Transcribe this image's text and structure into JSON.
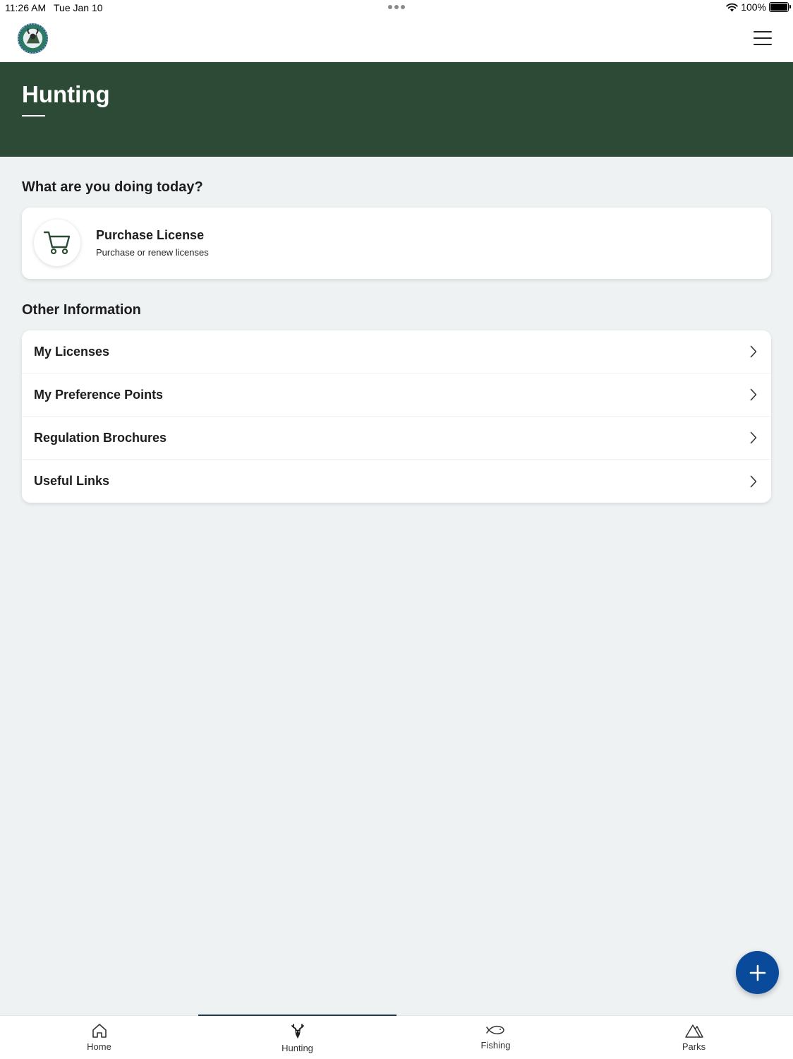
{
  "status_bar": {
    "time": "11:26 AM",
    "date": "Tue Jan 10",
    "battery": "100%"
  },
  "header": {
    "logo_icon": "colorado-parks-wildlife-logo",
    "menu_icon": "hamburger-menu-icon"
  },
  "hero": {
    "title": "Hunting"
  },
  "main": {
    "section1_title": "What are you doing today?",
    "purchase": {
      "title": "Purchase License",
      "subtitle": "Purchase or renew licenses",
      "icon": "shopping-cart-icon"
    },
    "section2_title": "Other Information",
    "info_items": [
      {
        "label": "My Licenses"
      },
      {
        "label": "My Preference Points"
      },
      {
        "label": "Regulation Brochures"
      },
      {
        "label": "Useful Links"
      }
    ]
  },
  "fab": {
    "icon": "plus-icon"
  },
  "bottom_nav": {
    "items": [
      {
        "label": "Home",
        "icon": "home-icon"
      },
      {
        "label": "Hunting",
        "icon": "deer-icon"
      },
      {
        "label": "Fishing",
        "icon": "fish-icon"
      },
      {
        "label": "Parks",
        "icon": "mountain-icon"
      }
    ],
    "active": "Hunting"
  },
  "colors": {
    "hero_bg": "#2d4a37",
    "page_bg": "#eef2f3",
    "fab": "#0a4a9a"
  }
}
